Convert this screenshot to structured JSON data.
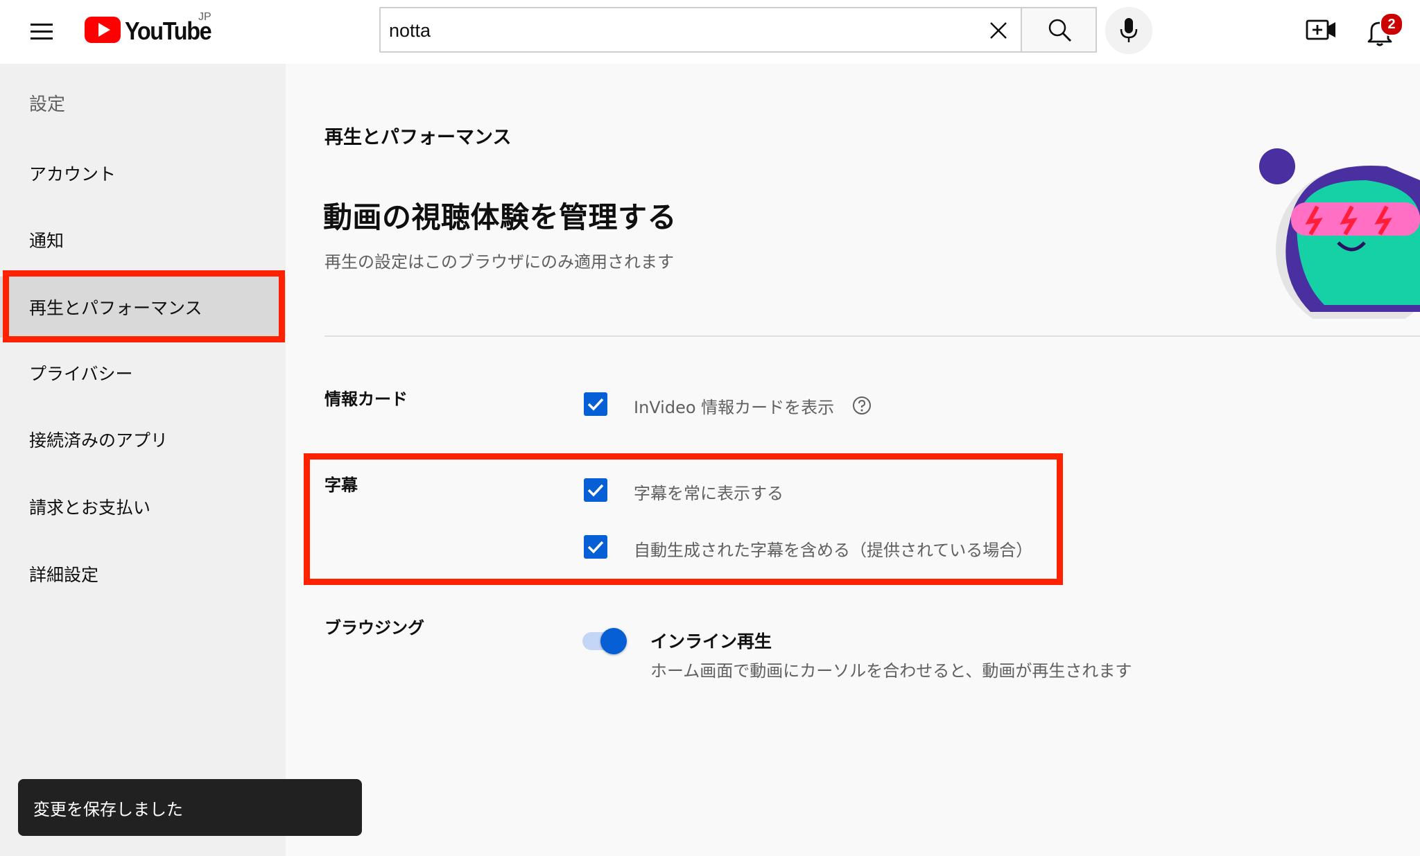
{
  "header": {
    "logo_text": "YouTube",
    "country_code": "JP",
    "search_value": "notta",
    "notification_count": "2",
    "icons": [
      "menu-icon",
      "youtube-logo-icon",
      "close-icon",
      "search-icon",
      "mic-icon",
      "create-video-icon",
      "bell-icon"
    ]
  },
  "sidebar": {
    "title": "設定",
    "items": [
      {
        "label": "アカウント"
      },
      {
        "label": "通知"
      },
      {
        "label": "再生とパフォーマンス",
        "active": true
      },
      {
        "label": "プライバシー"
      },
      {
        "label": "接続済みのアプリ"
      },
      {
        "label": "請求とお支払い"
      },
      {
        "label": "詳細設定"
      }
    ]
  },
  "main": {
    "section": "再生とパフォーマンス",
    "title": "動画の視聴体験を管理する",
    "subtitle": "再生の設定はこのブラウザにのみ適用されます",
    "info_cards": {
      "label": "情報カード",
      "option": "InVideo 情報カードを表示",
      "checked": true
    },
    "captions": {
      "label": "字幕",
      "options": [
        {
          "label": "字幕を常に表示する",
          "checked": true
        },
        {
          "label": "自動生成された字幕を含める（提供されている場合）",
          "checked": true
        }
      ]
    },
    "browsing": {
      "label": "ブラウジング",
      "toggle_title": "インライン再生",
      "toggle_desc": "ホーム画面で動画にカーソルを合わせると、動画が再生されます",
      "enabled": true
    }
  },
  "toast": {
    "message": "変更を保存しました"
  },
  "colors": {
    "accent": "#065fd4",
    "highlight": "#ff2200",
    "youtube_red": "#ff0000",
    "toast_bg": "#212121"
  }
}
